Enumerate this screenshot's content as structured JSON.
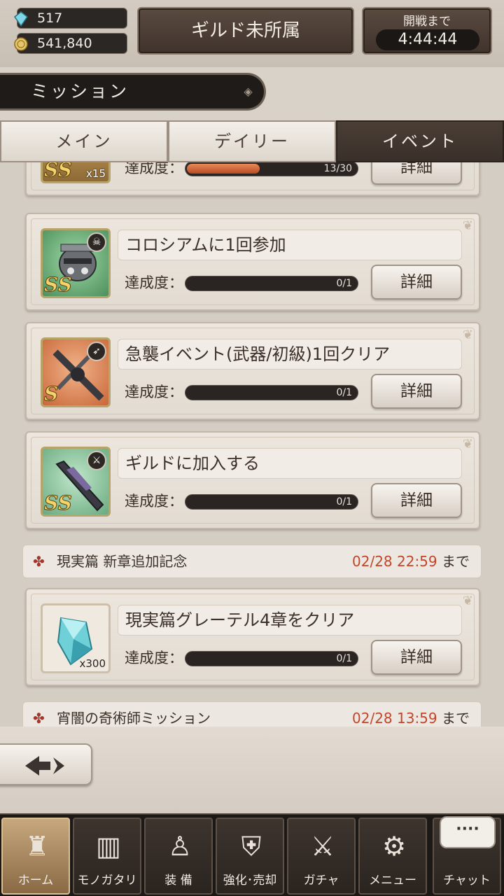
{
  "status": {
    "gems": "517",
    "coins": "541,840",
    "guild": "ギルド未所属",
    "timer_label": "開戦まで",
    "timer_value": "4:44:44"
  },
  "mission_panel": {
    "title": "ミッション",
    "tabs": [
      {
        "label": "メイン",
        "active": false
      },
      {
        "label": "デイリー",
        "active": false
      },
      {
        "label": "イベント",
        "active": true
      }
    ]
  },
  "missions": [
    {
      "title": "",
      "rank": "SS",
      "qty": "x15",
      "progress_label": "達成度：",
      "progress_text": "13/30",
      "progress": 0.43,
      "detail": "詳細"
    },
    {
      "title": "コロシアムに1回参加",
      "rank": "SS",
      "qty": "",
      "progress_label": "達成度：",
      "progress_text": "0/1",
      "progress": 0,
      "detail": "詳細"
    },
    {
      "title": "急襲イベント(武器/初級)1回クリア",
      "rank": "S",
      "qty": "",
      "progress_label": "達成度：",
      "progress_text": "0/1",
      "progress": 0,
      "detail": "詳細"
    },
    {
      "title": "ギルドに加入する",
      "rank": "SS",
      "qty": "",
      "progress_label": "達成度：",
      "progress_text": "0/1",
      "progress": 0,
      "detail": "詳細"
    },
    {
      "title": "現実篇グレーテル4章をクリア",
      "rank": "",
      "qty": "x300",
      "progress_label": "達成度：",
      "progress_text": "0/1",
      "progress": 0,
      "detail": "詳細"
    }
  ],
  "events": [
    {
      "name": "現実篇 新章追加記念",
      "date": "02/28 22:59",
      "until": "まで"
    },
    {
      "name": "宵闇の奇術師ミッション",
      "date": "02/28 13:59",
      "until": "まで"
    }
  ],
  "nav": {
    "items": [
      {
        "label": "ホーム",
        "active": true
      },
      {
        "label": "モノガタリ",
        "active": false
      },
      {
        "label": "装 備",
        "active": false
      },
      {
        "label": "強化･売却",
        "active": false
      },
      {
        "label": "ガチャ",
        "active": false
      },
      {
        "label": "メニュー",
        "active": false
      },
      {
        "label": "チャット",
        "active": false
      }
    ],
    "chat_bubble": "····"
  },
  "colors": {
    "accent_date": "#c2462a",
    "progress_fill": "#d06a3e",
    "nav_active": "#b08d62"
  }
}
